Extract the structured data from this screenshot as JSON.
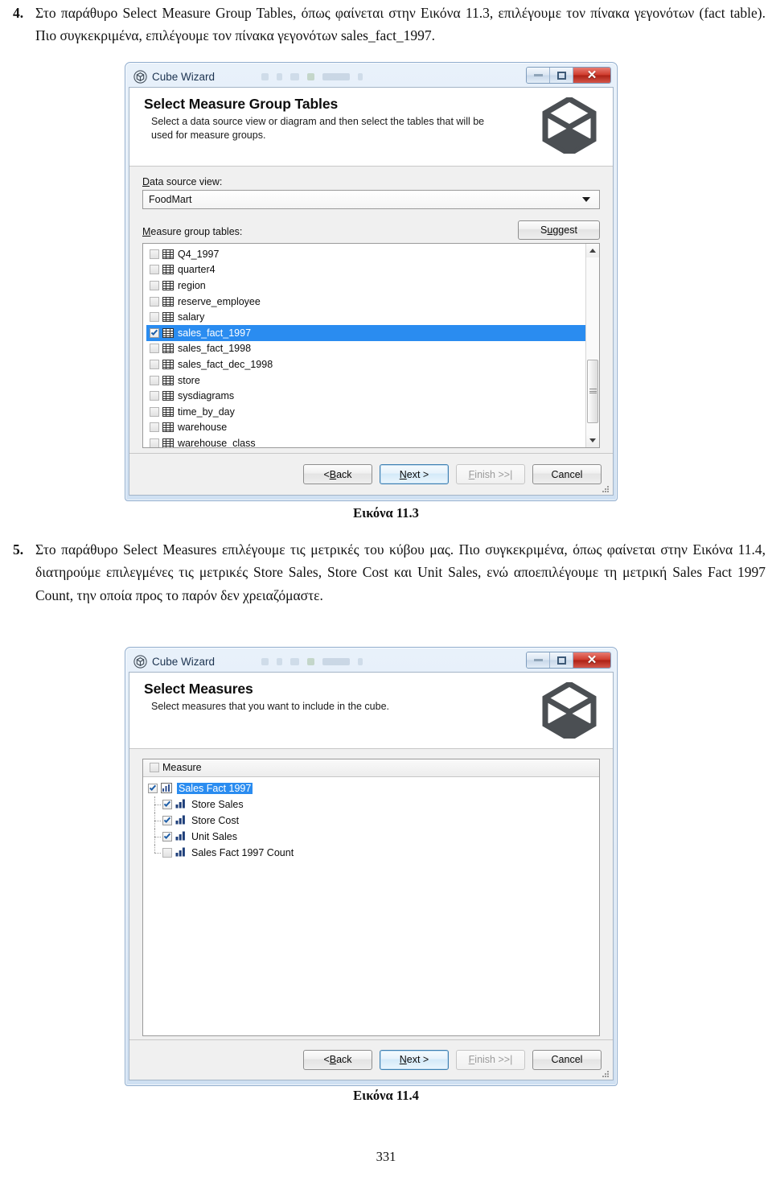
{
  "page": {
    "number": "331"
  },
  "paragraphs": [
    {
      "num": "4.",
      "text": "Στο παράθυρο Select Measure Group Tables, όπως φαίνεται στην Εικόνα 11.3,  επιλέγουμε τον πίνακα γεγονότων (fact table). Πιο συγκεκριμένα, επιλέγουμε τον πίνακα γεγονότων sales_fact_1997."
    },
    {
      "num": "5.",
      "text": "Στο παράθυρο Select Measures επιλέγουμε τις μετρικές του κύβου μας. Πιο συγκεκριμένα, όπως φαίνεται στην Εικόνα 11.4, διατηρούμε επιλεγμένες τις μετρικές Store Sales, Store Cost και Unit Sales, ενώ αποεπιλέγουμε τη μετρική Sales Fact 1997 Count, την οποία προς το παρόν δεν χρειαζόμαστε."
    }
  ],
  "captions": {
    "figure1": "Εικόνα 11.3",
    "figure2": "Εικόνα 11.4"
  },
  "dialog1": {
    "titlebar": {
      "icon": "cube-icon",
      "title": "Cube Wizard",
      "minimize_label": "minimize-icon",
      "maximize_label": "maximize-icon",
      "close_label": "✕"
    },
    "header": {
      "title": "Select Measure Group Tables",
      "subtitle": "Select a data source view or diagram and then select the tables that will be used for measure groups.",
      "art": "cube-outline-icon"
    },
    "data_source_view": {
      "label": "Data source view:",
      "label_accel": "D",
      "value": "FoodMart"
    },
    "measure_group_tables": {
      "label": "Measure group tables:",
      "label_accel": "M",
      "suggest_label": "Suggest",
      "suggest_accel": "u",
      "items": [
        {
          "name": "Q4_1997",
          "checked": false,
          "selected": false
        },
        {
          "name": "quarter4",
          "checked": false,
          "selected": false
        },
        {
          "name": "region",
          "checked": false,
          "selected": false
        },
        {
          "name": "reserve_employee",
          "checked": false,
          "selected": false
        },
        {
          "name": "salary",
          "checked": false,
          "selected": false
        },
        {
          "name": "sales_fact_1997",
          "checked": true,
          "selected": true
        },
        {
          "name": "sales_fact_1998",
          "checked": false,
          "selected": false
        },
        {
          "name": "sales_fact_dec_1998",
          "checked": false,
          "selected": false
        },
        {
          "name": "store",
          "checked": false,
          "selected": false
        },
        {
          "name": "sysdiagrams",
          "checked": false,
          "selected": false
        },
        {
          "name": "time_by_day",
          "checked": false,
          "selected": false
        },
        {
          "name": "warehouse",
          "checked": false,
          "selected": false
        },
        {
          "name": "warehouse_class",
          "checked": false,
          "selected": false
        }
      ]
    },
    "buttons": {
      "back": "< Back",
      "back_accel": "B",
      "next": "Next >",
      "next_accel": "N",
      "finish": "Finish >>|",
      "finish_accel": "F",
      "cancel": "Cancel"
    }
  },
  "dialog2": {
    "titlebar": {
      "icon": "cube-icon",
      "title": "Cube Wizard",
      "close_label": "✕"
    },
    "header": {
      "title": "Select Measures",
      "subtitle": "Select measures that you want to include in the cube.",
      "art": "cube-outline-icon"
    },
    "tree": {
      "column_header": "Measure",
      "header_checked": false,
      "root": {
        "name": "Sales Fact 1997",
        "checked": true,
        "selected": true
      },
      "children": [
        {
          "name": "Store Sales",
          "checked": true
        },
        {
          "name": "Store Cost",
          "checked": true
        },
        {
          "name": "Unit Sales",
          "checked": true
        },
        {
          "name": "Sales Fact 1997 Count",
          "checked": false
        }
      ]
    },
    "buttons": {
      "back": "< Back",
      "back_accel": "B",
      "next": "Next >",
      "next_accel": "N",
      "finish": "Finish >>|",
      "finish_accel": "F",
      "cancel": "Cancel"
    }
  },
  "colors": {
    "selection_blue": "#2a8cf0",
    "close_red": "#cf3b2d",
    "default_button_border": "#3c7fb1",
    "cube_art": "#4b4f53"
  }
}
